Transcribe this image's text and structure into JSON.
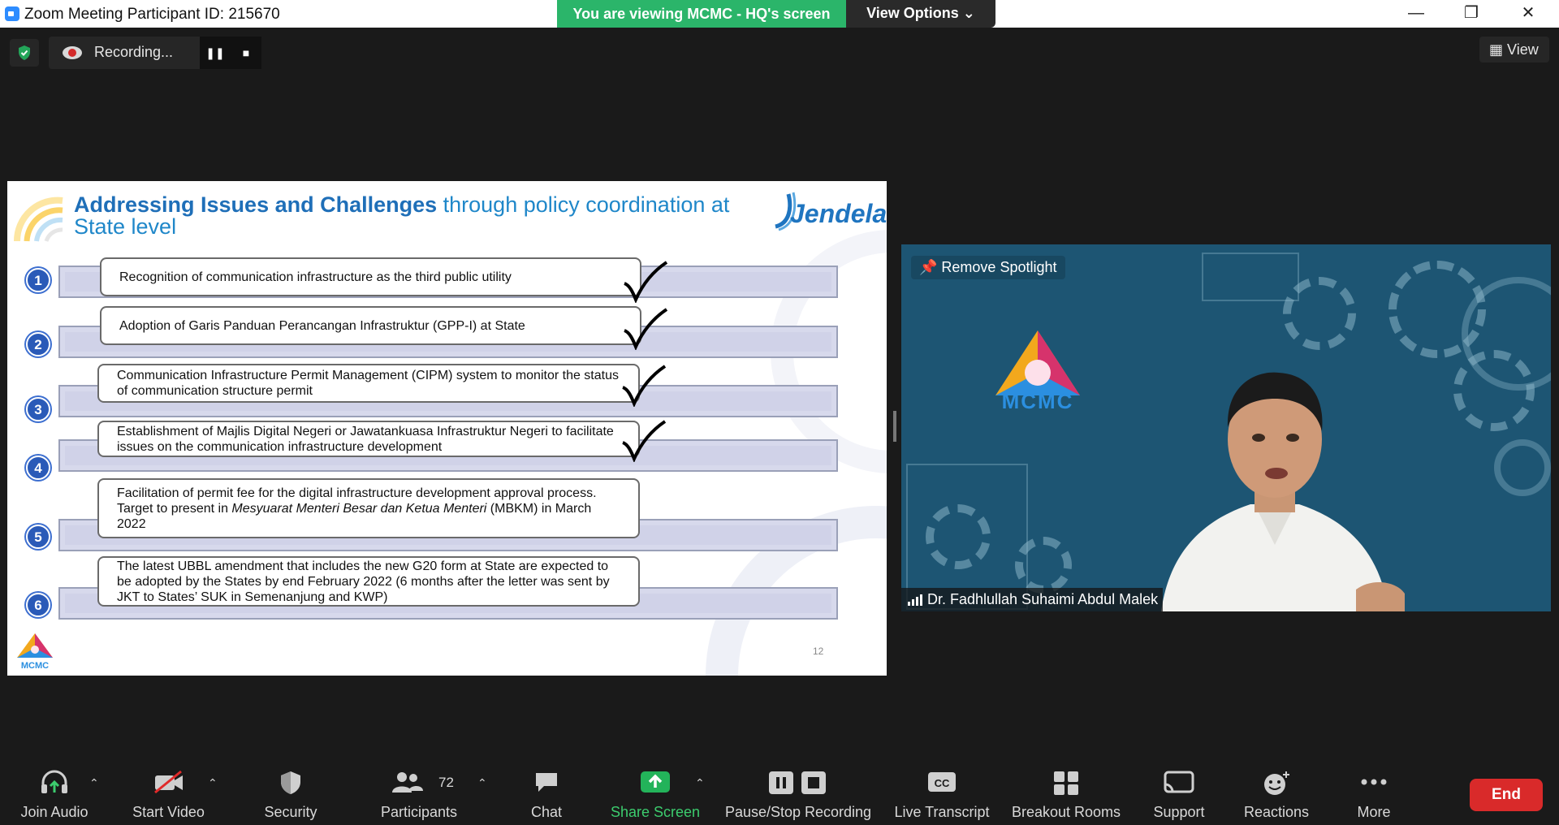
{
  "titlebar": {
    "title": "Zoom Meeting Participant ID: 215670",
    "viewing_banner": "You are viewing MCMC - HQ's screen",
    "view_options": "View Options ⌄",
    "minimize": "—",
    "restore": "❐",
    "close": "✕"
  },
  "recording": {
    "label": "Recording...",
    "pause": "❚❚",
    "stop": "■"
  },
  "view_button": "View",
  "slide": {
    "title_bold": "Addressing Issues and Challenges",
    "title_rest": " through policy coordination at State level",
    "brand": "Jendela",
    "page_number": "12",
    "items": [
      {
        "num": "1",
        "text": "Recognition of communication infrastructure as the third public utility"
      },
      {
        "num": "2",
        "text": "Adoption of Garis Panduan Perancangan Infrastruktur (GPP-I) at State"
      },
      {
        "num": "3",
        "text": "Communication Infrastructure Permit Management (CIPM) system to monitor the status of communication structure permit"
      },
      {
        "num": "4",
        "text": "Establishment of Majlis Digital Negeri or Jawatankuasa Infrastruktur Negeri to facilitate issues on the communication infrastructure development"
      },
      {
        "num": "5",
        "text_before": "Facilitation of permit fee for the digital infrastructure development approval process. Target to present in ",
        "text_italic": "Mesyuarat Menteri Besar dan Ketua Menteri",
        "text_after": " (MBKM) in March 2022"
      },
      {
        "num": "6",
        "text": "The latest UBBL amendment that includes the new G20 form at State are expected to be adopted by the States by end February 2022 (6 months after the letter was sent by JKT to States’ SUK in Semenanjung and KWP)"
      }
    ],
    "logo_text": "MCMC"
  },
  "video": {
    "spotlight_label": "Remove Spotlight",
    "logo_text": "MCMC",
    "participant_name": "Dr. Fadhlullah Suhaimi Abdul Malek"
  },
  "toolbar": {
    "join_audio": "Join Audio",
    "start_video": "Start Video",
    "security": "Security",
    "participants": "Participants",
    "participants_count": "72",
    "chat": "Chat",
    "share_screen": "Share Screen",
    "pause_stop_recording": "Pause/Stop Recording",
    "live_transcript": "Live Transcript",
    "breakout_rooms": "Breakout Rooms",
    "support": "Support",
    "reactions": "Reactions",
    "more": "More",
    "end": "End",
    "cc": "CC"
  },
  "colors": {
    "share_green": "#3ccc6e",
    "banner_green": "#2bb56a",
    "end_red": "#d92a2a",
    "slide_title_blue": "#1f87c9",
    "number_badge": "#2a5ab8"
  }
}
